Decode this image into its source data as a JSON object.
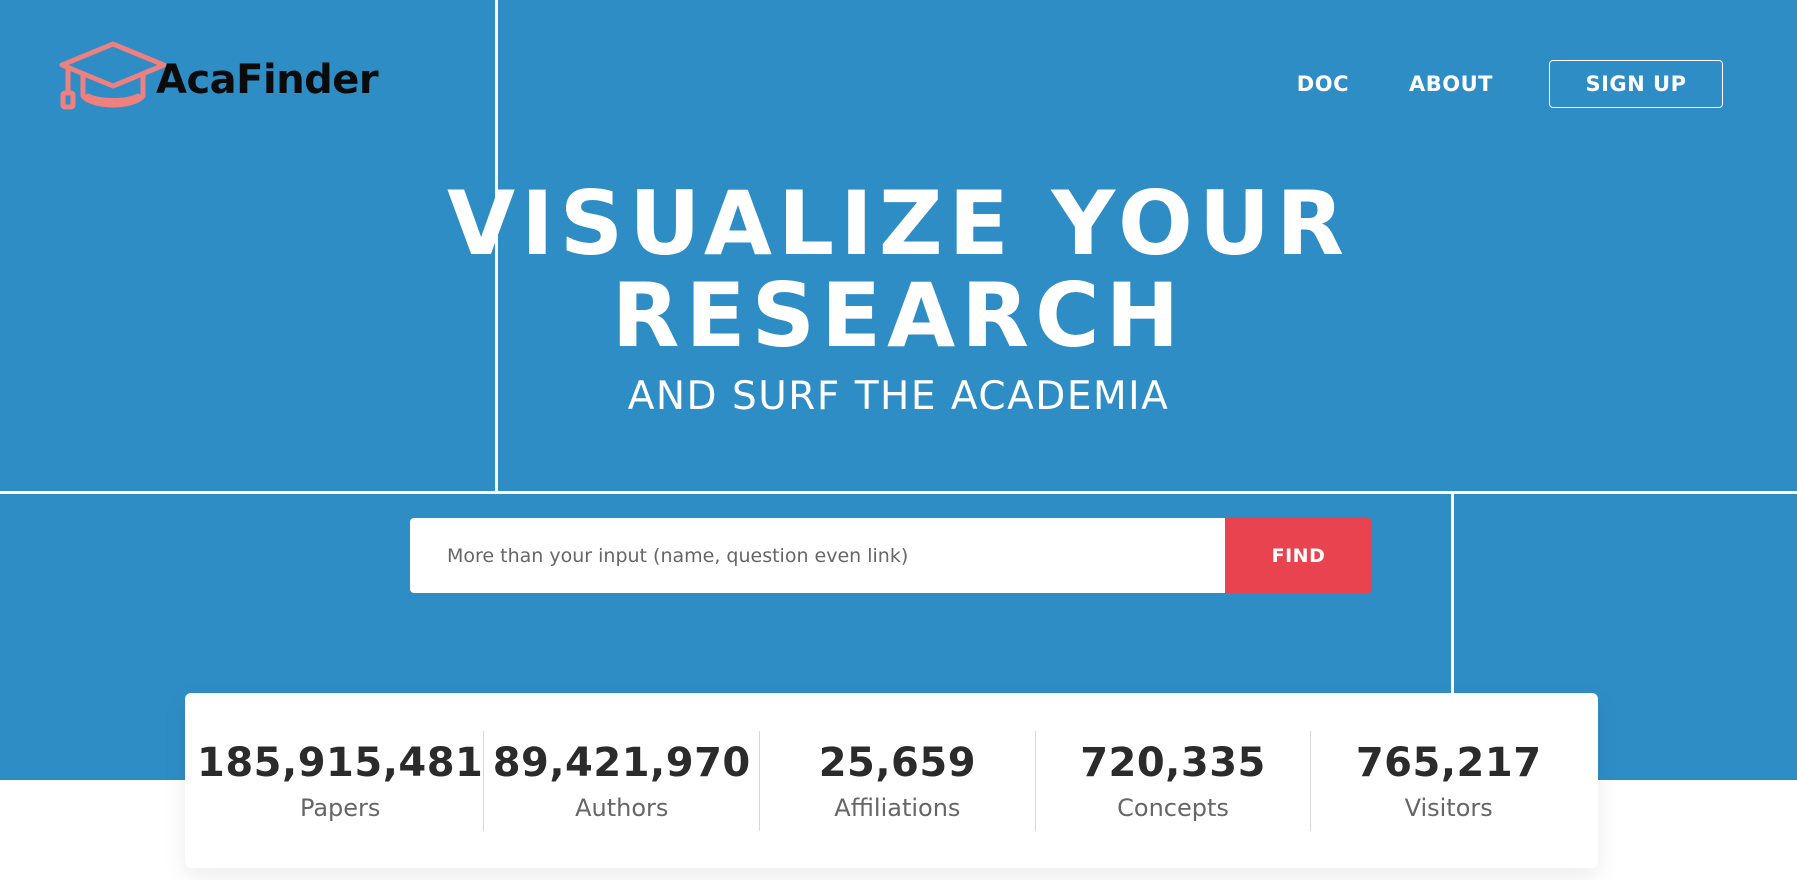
{
  "brand": {
    "name": "AcaFinder",
    "icon": "graduation-cap-icon",
    "icon_color": "#f08080"
  },
  "nav": {
    "items": [
      {
        "label": "DOC"
      },
      {
        "label": "ABOUT"
      }
    ],
    "signup_label": "SIGN UP"
  },
  "hero": {
    "title_line1": "VISUALIZE YOUR",
    "title_line2": "RESEARCH",
    "subtitle": "AND SURF THE ACADEMIA",
    "background_color": "#2f8dc6"
  },
  "search": {
    "placeholder": "More than your input (name, question even link)",
    "value": "",
    "button_label": "FIND",
    "button_color": "#e8434f"
  },
  "stats": [
    {
      "value": "185,915,481",
      "label": "Papers"
    },
    {
      "value": "89,421,970",
      "label": "Authors"
    },
    {
      "value": "25,659",
      "label": "Affiliations"
    },
    {
      "value": "720,335",
      "label": "Concepts"
    },
    {
      "value": "765,217",
      "label": "Visitors"
    }
  ]
}
